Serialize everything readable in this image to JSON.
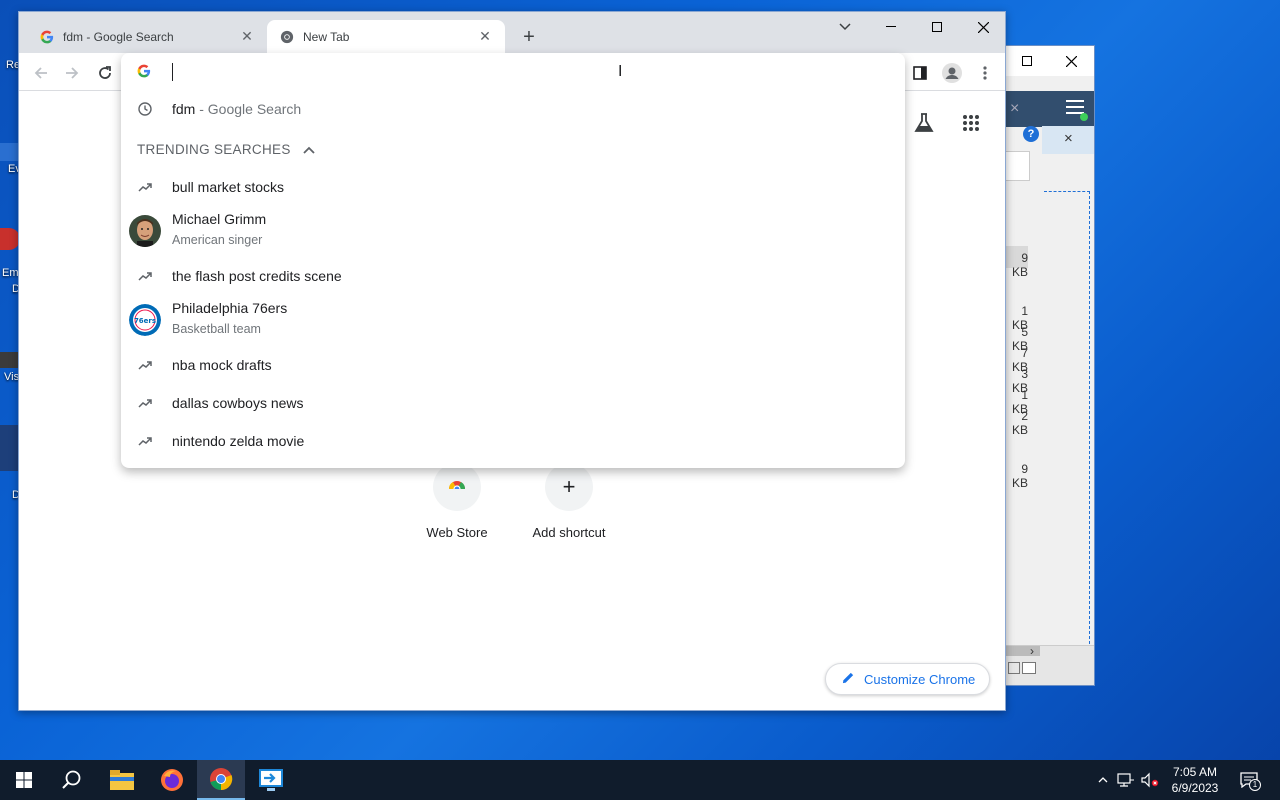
{
  "desktop": {
    "fragments": [
      "Re",
      "Ev",
      "Em",
      "D",
      "Vis",
      "D"
    ]
  },
  "background_window": {
    "sizes": [
      "9 KB",
      "1 KB",
      "5 KB",
      "7 KB",
      "3 KB",
      "1 KB",
      "2 KB",
      "9 KB"
    ],
    "close_x": "×"
  },
  "browser": {
    "tabs": [
      {
        "title": "fdm - Google Search",
        "favicon": "google-g-icon",
        "active": false
      },
      {
        "title": "New Tab",
        "favicon": "chrome-icon",
        "active": true
      }
    ],
    "omnibox": {
      "value": "",
      "history": [
        {
          "query": "fdm",
          "suffix": " - Google Search"
        }
      ],
      "trending_header": "TRENDING SEARCHES",
      "trending": [
        {
          "text": "bull market stocks",
          "sub": "",
          "kind": "trend"
        },
        {
          "text": "Michael Grimm",
          "sub": "American singer",
          "kind": "person"
        },
        {
          "text": "the flash post credits scene",
          "sub": "",
          "kind": "trend"
        },
        {
          "text": "Philadelphia 76ers",
          "sub": "Basketball team",
          "kind": "team"
        },
        {
          "text": "nba mock drafts",
          "sub": "",
          "kind": "trend"
        },
        {
          "text": "dallas cowboys news",
          "sub": "",
          "kind": "trend"
        },
        {
          "text": "nintendo zelda movie",
          "sub": "",
          "kind": "trend"
        }
      ],
      "team_logo_text": "76ers"
    },
    "ntp": {
      "shortcuts": [
        {
          "label": "Web Store",
          "icon": "web-store-icon"
        },
        {
          "label": "Add shortcut",
          "icon": "plus-icon",
          "glyph": "+"
        }
      ],
      "customize_label": "Customize Chrome"
    }
  },
  "taskbar": {
    "time": "7:05 AM",
    "date": "6/9/2023",
    "notification_count": "1"
  },
  "colors": {
    "accent": "#1a73e8",
    "desktop": "#0a63d6",
    "taskbar": "#101c2c"
  }
}
